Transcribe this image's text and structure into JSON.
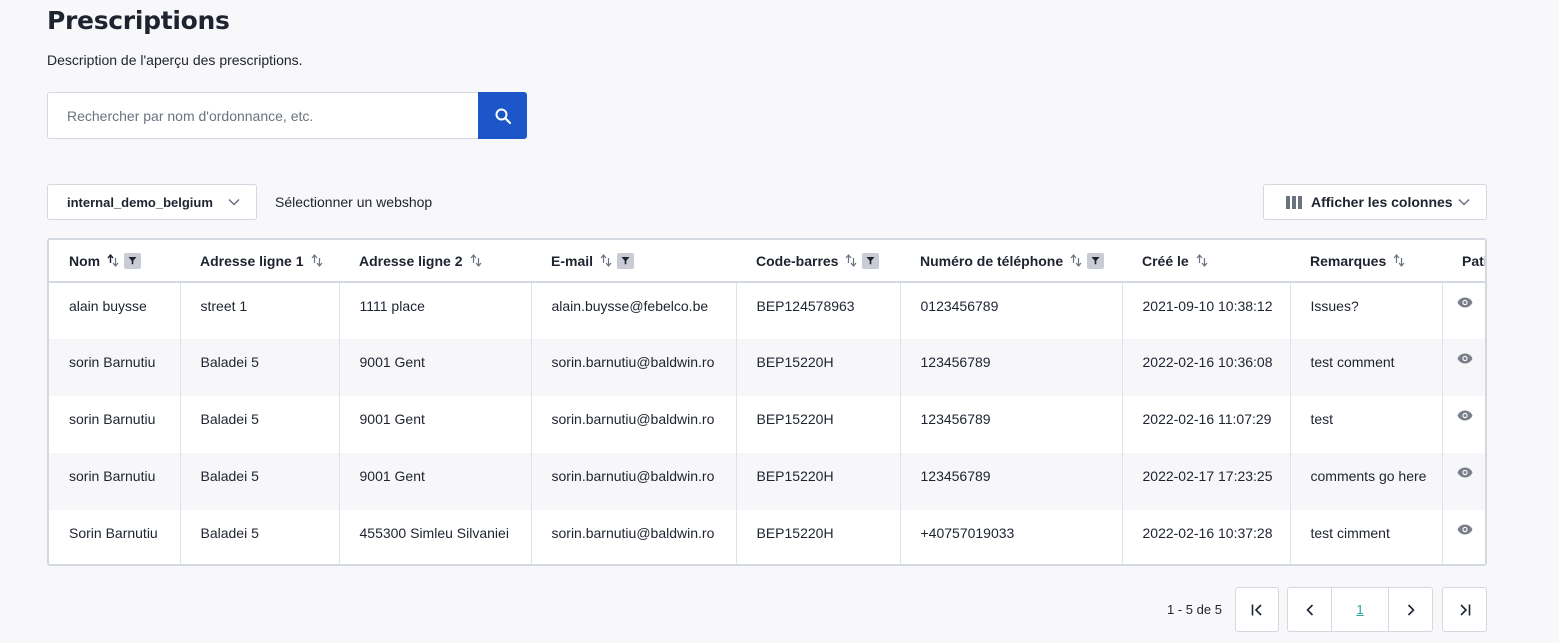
{
  "header": {
    "title": "Prescriptions",
    "description": "Description de l'aperçu des prescriptions."
  },
  "search": {
    "placeholder": "Rechercher par nom d'ordonnance, etc.",
    "value": ""
  },
  "filters": {
    "webshop_value": "internal_demo_belgium",
    "webshop_label": "Sélectionner un webshop",
    "columns_button": "Afficher les colonnes"
  },
  "table": {
    "columns": [
      {
        "label": "Nom",
        "sortable": true,
        "filterable": true
      },
      {
        "label": "Adresse ligne 1",
        "sortable": true,
        "filterable": false
      },
      {
        "label": "Adresse ligne 2",
        "sortable": true,
        "filterable": false
      },
      {
        "label": "E-mail",
        "sortable": true,
        "filterable": true
      },
      {
        "label": "Code-barres",
        "sortable": true,
        "filterable": true
      },
      {
        "label": "Numéro de téléphone",
        "sortable": true,
        "filterable": true
      },
      {
        "label": "Créé le",
        "sortable": true,
        "filterable": false
      },
      {
        "label": "Remarques",
        "sortable": true,
        "filterable": false
      },
      {
        "label": "Patient",
        "sortable": false,
        "filterable": false
      }
    ],
    "rows": [
      [
        "alain buysse",
        "street 1",
        "1111 place",
        "alain.buysse@febelco.be",
        "BEP124578963",
        "0123456789",
        "2021-09-10 10:38:12",
        "Issues?"
      ],
      [
        "sorin Barnutiu",
        "Baladei 5",
        "9001 Gent",
        "sorin.barnutiu@baldwin.ro",
        "BEP15220H",
        "123456789",
        "2022-02-16 10:36:08",
        "test comment"
      ],
      [
        "sorin Barnutiu",
        "Baladei 5",
        "9001 Gent",
        "sorin.barnutiu@baldwin.ro",
        "BEP15220H",
        "123456789",
        "2022-02-16 11:07:29",
        "test"
      ],
      [
        "sorin Barnutiu",
        "Baladei 5",
        "9001 Gent",
        "sorin.barnutiu@baldwin.ro",
        "BEP15220H",
        "123456789",
        "2022-02-17 17:23:25",
        "comments go here"
      ],
      [
        "Sorin Barnutiu",
        "Baladei 5",
        "455300 Simleu Silvaniei",
        "sorin.barnutiu@baldwin.ro",
        "BEP15220H",
        "+40757019033",
        "2022-02-16 10:37:28",
        "test cimment"
      ]
    ],
    "row_action_icon": "eye-icon"
  },
  "pagination": {
    "info": "1 - 5 de 5",
    "current_page": "1"
  },
  "colors": {
    "primary": "#1c56c9",
    "page_link": "#2aa39b",
    "background": "#f8f8fa"
  }
}
